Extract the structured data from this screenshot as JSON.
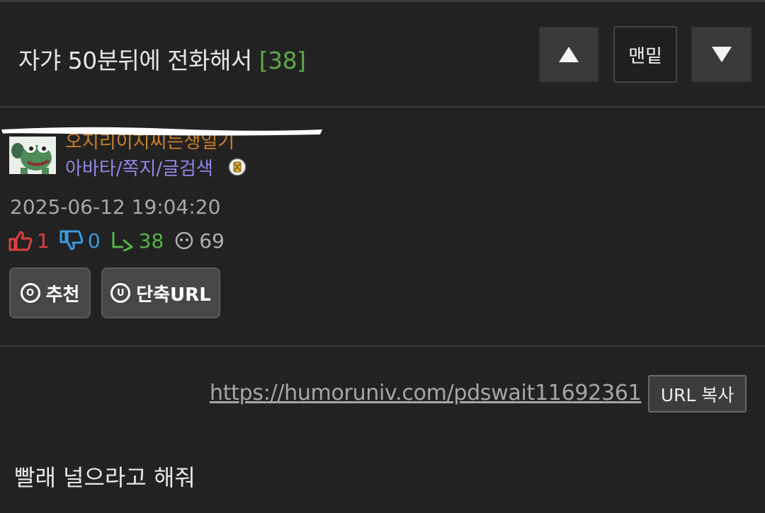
{
  "header": {
    "title": "자갸 50분뒤에 전화해서",
    "comment_count": "[38]",
    "up_icon": "triangle-up-icon",
    "bottom_label": "맨밑",
    "down_icon": "triangle-down-icon"
  },
  "author": {
    "avatar_icon": "frog-avatar-icon",
    "nickname": "오지리이지씨는생일기",
    "links": "아바타/쪽지/글검색",
    "badge_icon": "member-badge-icon"
  },
  "post": {
    "datetime": "2025-06-12 19:04:20",
    "stats": {
      "likes": "1",
      "dislikes": "0",
      "comments": "38",
      "views": "69"
    },
    "buttons": {
      "recommend_icon": "O",
      "recommend": "추천",
      "shorturl_icon": "U",
      "shorturl": "단축URL"
    },
    "short_url": "https://humoruniv.com/pdswait11692361",
    "copy_label": "URL 복사",
    "content": "빨래 널으라고 해줘"
  },
  "colors": {
    "background": "#222222",
    "comment_count": "#5fa84a",
    "nickname": "#c97f2a",
    "links": "#8f86e8",
    "like": "#e04040",
    "dislike": "#3b9ae0",
    "comment": "#56b34a"
  }
}
